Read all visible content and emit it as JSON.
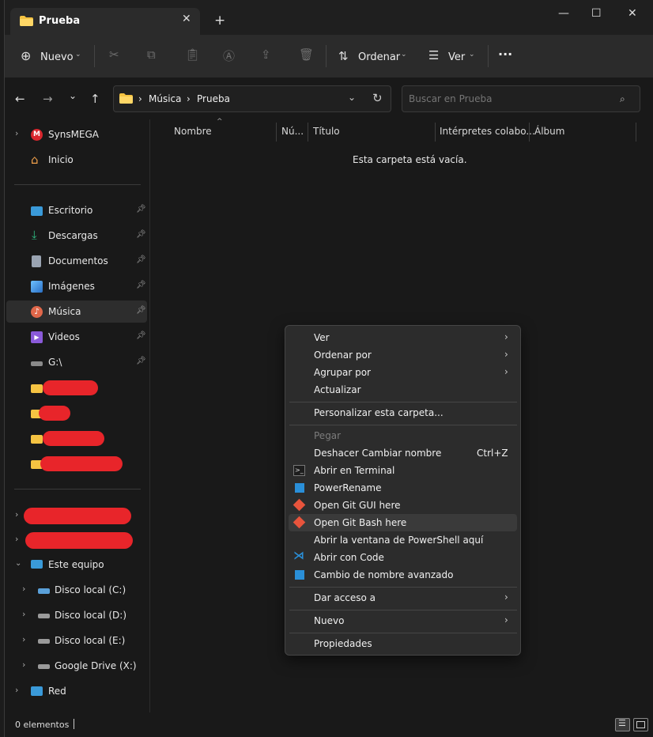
{
  "tab": {
    "title": "Prueba",
    "close_glyph": "✕",
    "new_glyph": "+"
  },
  "window_controls": {
    "minimize": "—",
    "maximize": "☐",
    "close": "✕"
  },
  "command_bar": {
    "new_label": "Nuevo",
    "sort_label": "Ordenar",
    "view_label": "Ver",
    "more": "···"
  },
  "address": {
    "crumbs": [
      "Música",
      "Prueba"
    ],
    "separator": "›"
  },
  "search": {
    "placeholder": "Buscar en Prueba"
  },
  "sidebar": {
    "items": [
      {
        "label": "SynsMEGA",
        "icon": "mega-icon",
        "color": "#d9272e"
      },
      {
        "label": "Inicio",
        "icon": "home-icon",
        "color": "#f0a04b"
      },
      {
        "label": "Escritorio",
        "icon": "desktop-icon",
        "color": "#3a9ad9"
      },
      {
        "label": "Descargas",
        "icon": "download-icon",
        "color": "#2fb880"
      },
      {
        "label": "Documentos",
        "icon": "document-icon",
        "color": "#9aa4b2"
      },
      {
        "label": "Imágenes",
        "icon": "pictures-icon",
        "color": "#3a8fd9"
      },
      {
        "label": "Música",
        "icon": "music-icon",
        "color": "#e0674a"
      },
      {
        "label": "Videos",
        "icon": "videos-icon",
        "color": "#8a5ad9"
      },
      {
        "label": "G:\\",
        "icon": "drive-icon",
        "color": "#bbbbbb"
      },
      {
        "label": "Este equipo",
        "icon": "computer-icon",
        "color": "#3a9ad9"
      },
      {
        "label": "Disco local (C:)",
        "icon": "drive-icon",
        "color": "#5aa0d9"
      },
      {
        "label": "Disco local (D:)",
        "icon": "drive-icon",
        "color": "#bbbbbb"
      },
      {
        "label": "Disco local (E:)",
        "icon": "drive-icon",
        "color": "#bbbbbb"
      },
      {
        "label": "Google Drive (X:)",
        "icon": "drive-icon",
        "color": "#bbbbbb"
      },
      {
        "label": "Red",
        "icon": "network-icon",
        "color": "#3a9ad9"
      }
    ]
  },
  "columns": [
    "Nombre",
    "Nú...",
    "Título",
    "Intérpretes colabo...",
    "Álbum"
  ],
  "empty_message": "Esta carpeta está vacía.",
  "status": {
    "item_count": "0 elementos"
  },
  "context_menu": {
    "items": [
      {
        "label": "Ver"
      },
      {
        "label": "Ordenar por"
      },
      {
        "label": "Agrupar por"
      },
      {
        "label": "Actualizar"
      },
      {
        "label": "Personalizar esta carpeta..."
      },
      {
        "label": "Pegar"
      },
      {
        "label": "Deshacer Cambiar nombre",
        "shortcut": "Ctrl+Z"
      },
      {
        "label": "Abrir en Terminal"
      },
      {
        "label": "PowerRename"
      },
      {
        "label": "Open Git GUI here"
      },
      {
        "label": "Open Git Bash here"
      },
      {
        "label": "Abrir la ventana de PowerShell aquí"
      },
      {
        "label": "Abrir con Code"
      },
      {
        "label": "Cambio de nombre avanzado"
      },
      {
        "label": "Dar acceso a"
      },
      {
        "label": "Nuevo"
      },
      {
        "label": "Propiedades"
      }
    ],
    "submenu_glyph": "›"
  },
  "accent_colors": {
    "folder": "#f5c342",
    "git": "#e8543c",
    "vscode": "#2a8fd8",
    "redaction": "#e8252a"
  }
}
